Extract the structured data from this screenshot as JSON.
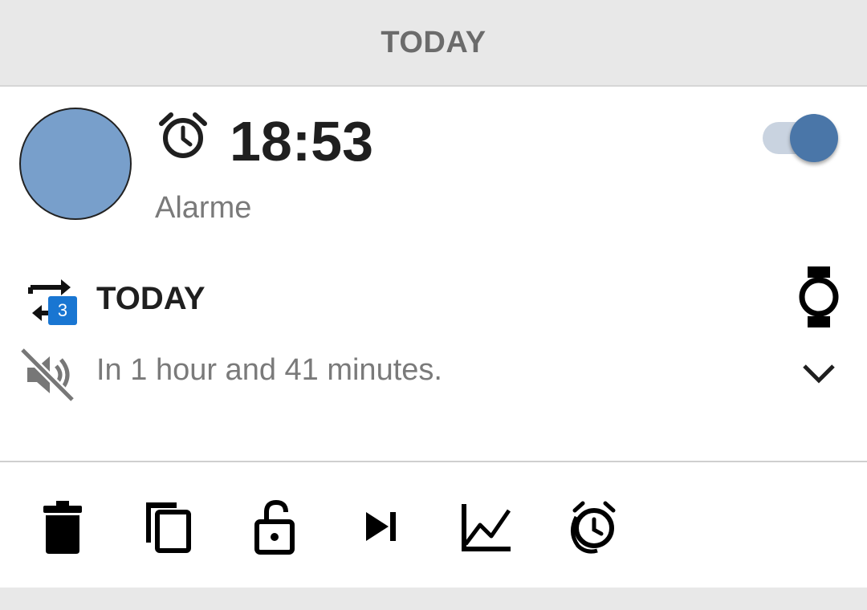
{
  "section": {
    "title": "TODAY"
  },
  "alarm": {
    "time": "18:53",
    "label": "Alarme",
    "enabled": true,
    "avatar_color": "#789fcb",
    "repeat_text": "TODAY",
    "repeat_badge": "3",
    "remaining_text": "In 1 hour and 41 minutes."
  },
  "colors": {
    "accent": "#4a76a8",
    "toggle_track": "#c9d3e0",
    "badge": "#1976d2"
  },
  "icons": {
    "alarm": "alarm-clock-icon",
    "repeat": "repeat-icon",
    "watch": "watch-icon",
    "mute": "volume-off-icon",
    "expand": "chevron-down-icon",
    "actions": [
      "trash-icon",
      "copy-icon",
      "lock-open-icon",
      "skip-next-icon",
      "chart-icon",
      "snooze-icon"
    ]
  }
}
